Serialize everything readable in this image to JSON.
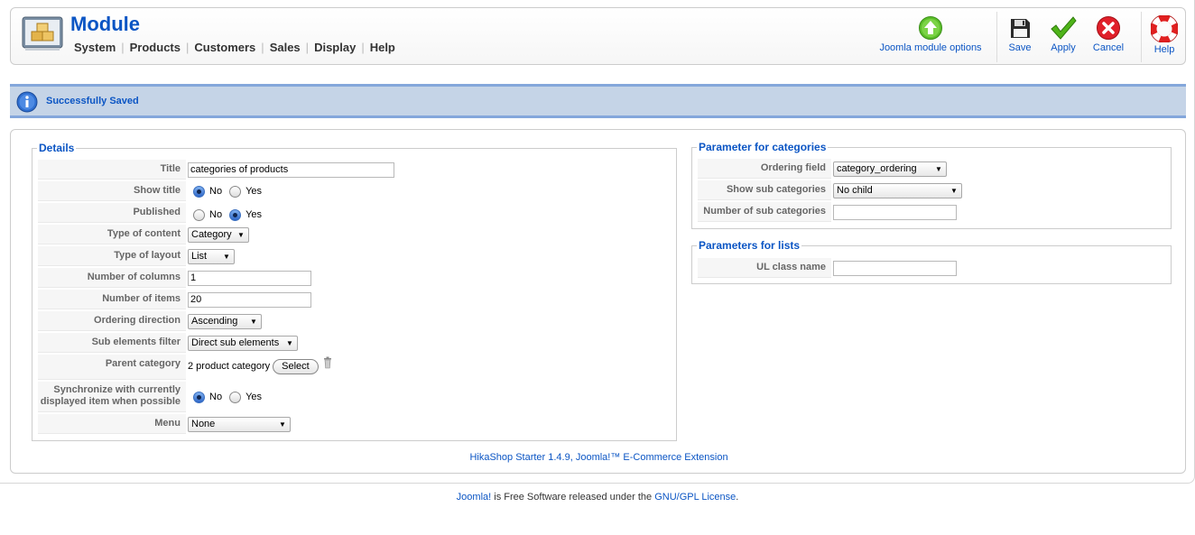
{
  "header": {
    "title": "Module",
    "menu": [
      "System",
      "Products",
      "Customers",
      "Sales",
      "Display",
      "Help"
    ]
  },
  "toolbar": {
    "options_label": "Joomla module options",
    "save_label": "Save",
    "apply_label": "Apply",
    "cancel_label": "Cancel",
    "help_label": "Help"
  },
  "message": {
    "text": "Successfully Saved"
  },
  "details": {
    "legend": "Details",
    "title_label": "Title",
    "title_value": "categories of products",
    "show_title_label": "Show title",
    "show_title_value": "No",
    "published_label": "Published",
    "published_value": "Yes",
    "type_of_content_label": "Type of content",
    "type_of_content_value": "Category",
    "type_of_layout_label": "Type of layout",
    "type_of_layout_value": "List",
    "number_of_columns_label": "Number of columns",
    "number_of_columns_value": "1",
    "number_of_items_label": "Number of items",
    "number_of_items_value": "20",
    "ordering_direction_label": "Ordering direction",
    "ordering_direction_value": "Ascending",
    "sub_elements_filter_label": "Sub elements filter",
    "sub_elements_filter_value": "Direct sub elements",
    "parent_category_label": "Parent category",
    "parent_category_value": "2 product category",
    "select_button": "Select",
    "sync_label_1": "Synchronize with currently",
    "sync_label_2": "displayed item when possible",
    "sync_value": "No",
    "menu_label": "Menu",
    "menu_value": "None",
    "no_label": "No",
    "yes_label": "Yes"
  },
  "categories": {
    "legend": "Parameter for categories",
    "ordering_field_label": "Ordering field",
    "ordering_field_value": "category_ordering",
    "show_sub_categories_label": "Show sub categories",
    "show_sub_categories_value": "No child",
    "number_of_sub_categories_label": "Number of sub categories",
    "number_of_sub_categories_value": ""
  },
  "lists": {
    "legend": "Parameters for lists",
    "ul_class_name_label": "UL class name",
    "ul_class_name_value": ""
  },
  "credit": "HikaShop Starter 1.4.9, Joomla!™ E-Commerce Extension",
  "footer": {
    "joomla_link": "Joomla!",
    "middle_text": " is Free Software released under the ",
    "license_link": "GNU/GPL License",
    "end_text": "."
  },
  "colors": {
    "brand_blue": "#0b55c4",
    "message_bg": "#c5d4e7"
  }
}
